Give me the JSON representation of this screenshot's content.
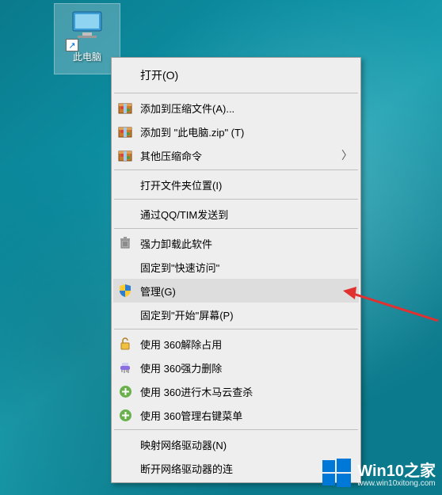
{
  "desktop_icon": {
    "label": "此电脑"
  },
  "menu": {
    "open": "打开(O)",
    "add_archive": "添加到压缩文件(A)...",
    "add_zip": "添加到 \"此电脑.zip\" (T)",
    "other_compress": "其他压缩命令",
    "open_location": "打开文件夹位置(I)",
    "qq_send": "通过QQ/TIM发送到",
    "force_uninstall": "强力卸载此软件",
    "pin_quick": "固定到\"快速访问\"",
    "manage": "管理(G)",
    "pin_start": "固定到\"开始\"屏幕(P)",
    "unlock_360": "使用 360解除占用",
    "force_del_360": "使用 360强力删除",
    "trojan_360": "使用 360进行木马云查杀",
    "rmenu_360": "使用 360管理右键菜单",
    "map_drive": "映射网络驱动器(N)",
    "disconnect_drive": "断开网络驱动器的连"
  },
  "watermark": {
    "title": "Win10之家",
    "url": "www.win10xitong.com"
  }
}
